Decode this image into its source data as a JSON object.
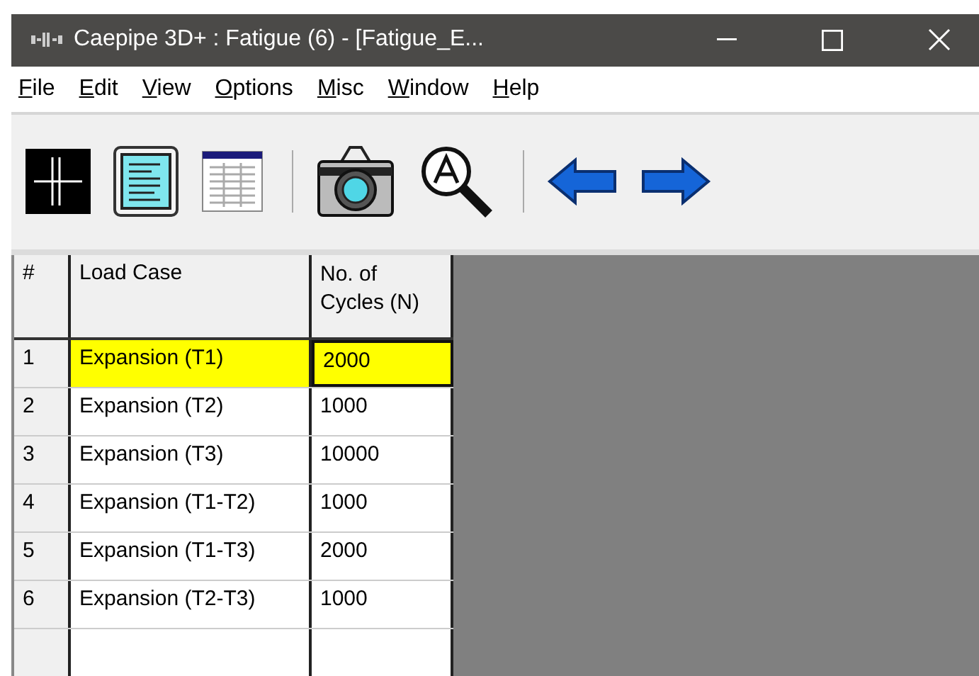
{
  "window": {
    "title": "Caepipe 3D+ : Fatigue  (6)  -  [Fatigue_E..."
  },
  "menu": [
    "File",
    "Edit",
    "View",
    "Options",
    "Misc",
    "Window",
    "Help"
  ],
  "table": {
    "columns": [
      "#",
      "Load Case",
      "No. of Cycles (N)"
    ],
    "rows": [
      {
        "index": "1",
        "load_case": "Expansion (T1)",
        "cycles": "2000",
        "selected": true
      },
      {
        "index": "2",
        "load_case": "Expansion (T2)",
        "cycles": "1000",
        "selected": false
      },
      {
        "index": "3",
        "load_case": "Expansion (T3)",
        "cycles": "10000",
        "selected": false
      },
      {
        "index": "4",
        "load_case": "Expansion (T1-T2)",
        "cycles": "1000",
        "selected": false
      },
      {
        "index": "5",
        "load_case": "Expansion (T1-T3)",
        "cycles": "2000",
        "selected": false
      },
      {
        "index": "6",
        "load_case": "Expansion (T2-T3)",
        "cycles": "1000",
        "selected": false
      }
    ]
  }
}
